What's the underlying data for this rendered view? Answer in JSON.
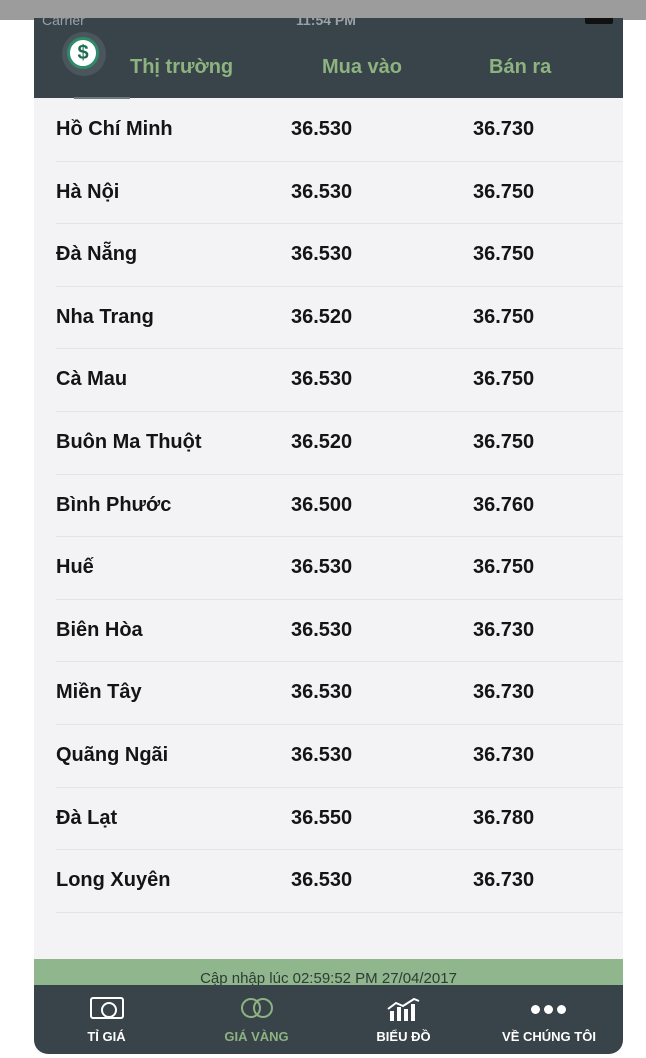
{
  "status_bar": {
    "carrier": "Carrier",
    "time": "11:54 PM"
  },
  "header": {
    "col_market": "Thị trường",
    "col_buy": "Mua vào",
    "col_sell": "Bán ra"
  },
  "rows": [
    {
      "city": "Hồ Chí Minh",
      "buy": "36.530",
      "sell": "36.730"
    },
    {
      "city": "Hà Nội",
      "buy": "36.530",
      "sell": "36.750"
    },
    {
      "city": "Đà Nẵng",
      "buy": "36.530",
      "sell": "36.750"
    },
    {
      "city": "Nha Trang",
      "buy": "36.520",
      "sell": "36.750"
    },
    {
      "city": "Cà Mau",
      "buy": "36.530",
      "sell": "36.750"
    },
    {
      "city": "Buôn Ma Thuột",
      "buy": "36.520",
      "sell": "36.750"
    },
    {
      "city": "Bình Phước",
      "buy": "36.500",
      "sell": "36.760"
    },
    {
      "city": "Huế",
      "buy": "36.530",
      "sell": "36.750"
    },
    {
      "city": "Biên Hòa",
      "buy": "36.530",
      "sell": "36.730"
    },
    {
      "city": "Miền Tây",
      "buy": "36.530",
      "sell": "36.730"
    },
    {
      "city": "Quãng Ngãi",
      "buy": "36.530",
      "sell": "36.730"
    },
    {
      "city": "Đà Lạt",
      "buy": "36.550",
      "sell": "36.780"
    },
    {
      "city": "Long Xuyên",
      "buy": "36.530",
      "sell": "36.730"
    }
  ],
  "update_text": "Cập nhập lúc 02:59:52 PM 27/04/2017",
  "tabs": [
    {
      "label": "TỈ GIÁ",
      "icon": "money-icon"
    },
    {
      "label": "GIÁ VÀNG",
      "icon": "rings-icon",
      "active": true
    },
    {
      "label": "BIỂU ĐỒ",
      "icon": "chart-icon"
    },
    {
      "label": "VỀ CHÚNG TÔI",
      "icon": "more-dots-icon"
    }
  ],
  "colors": {
    "header_bg": "#39434a",
    "accent_green": "#8db37f",
    "list_bg": "#f3f3f5",
    "update_bar": "#8fb68d"
  }
}
